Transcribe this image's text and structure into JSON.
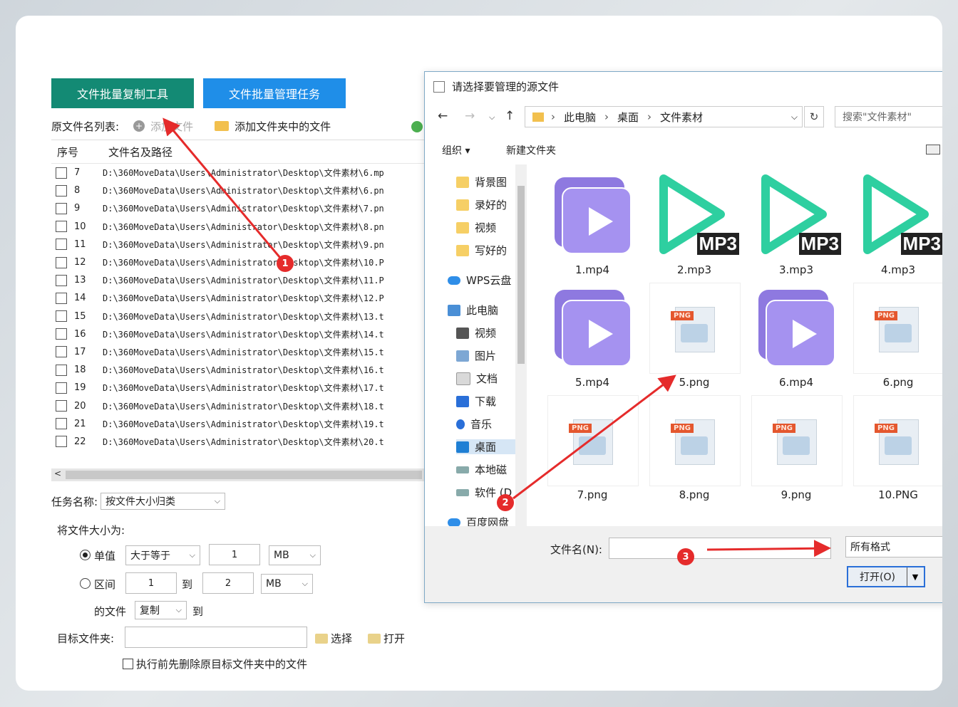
{
  "app": {
    "tabs": [
      {
        "label": "文件批量复制工具"
      },
      {
        "label": "文件批量管理任务"
      }
    ],
    "file_list_label": "原文件名列表:",
    "add_file_label": "添加文件",
    "add_folder_label": "添加文件夹中的文件",
    "table": {
      "headers": {
        "index": "序号",
        "path": "文件名及路径"
      },
      "rows": [
        {
          "index": "7",
          "path": "D:\\360MoveData\\Users\\Administrator\\Desktop\\文件素材\\6.mp"
        },
        {
          "index": "8",
          "path": "D:\\360MoveData\\Users\\Administrator\\Desktop\\文件素材\\6.pn"
        },
        {
          "index": "9",
          "path": "D:\\360MoveData\\Users\\Administrator\\Desktop\\文件素材\\7.pn"
        },
        {
          "index": "10",
          "path": "D:\\360MoveData\\Users\\Administrator\\Desktop\\文件素材\\8.pn"
        },
        {
          "index": "11",
          "path": "D:\\360MoveData\\Users\\Administrator\\Desktop\\文件素材\\9.pn"
        },
        {
          "index": "12",
          "path": "D:\\360MoveData\\Users\\Administrator\\Desktop\\文件素材\\10.P"
        },
        {
          "index": "13",
          "path": "D:\\360MoveData\\Users\\Administrator\\Desktop\\文件素材\\11.P"
        },
        {
          "index": "14",
          "path": "D:\\360MoveData\\Users\\Administrator\\Desktop\\文件素材\\12.P"
        },
        {
          "index": "15",
          "path": "D:\\360MoveData\\Users\\Administrator\\Desktop\\文件素材\\13.t"
        },
        {
          "index": "16",
          "path": "D:\\360MoveData\\Users\\Administrator\\Desktop\\文件素材\\14.t"
        },
        {
          "index": "17",
          "path": "D:\\360MoveData\\Users\\Administrator\\Desktop\\文件素材\\15.t"
        },
        {
          "index": "18",
          "path": "D:\\360MoveData\\Users\\Administrator\\Desktop\\文件素材\\16.t"
        },
        {
          "index": "19",
          "path": "D:\\360MoveData\\Users\\Administrator\\Desktop\\文件素材\\17.t"
        },
        {
          "index": "20",
          "path": "D:\\360MoveData\\Users\\Administrator\\Desktop\\文件素材\\18.t"
        },
        {
          "index": "21",
          "path": "D:\\360MoveData\\Users\\Administrator\\Desktop\\文件素材\\19.t"
        },
        {
          "index": "22",
          "path": "D:\\360MoveData\\Users\\Administrator\\Desktop\\文件素材\\20.t"
        }
      ]
    },
    "task": {
      "name_label": "任务名称:",
      "name_value": "按文件大小归类",
      "size_label": "将文件大小为:",
      "single_label": "单值",
      "single_cmp": "大于等于",
      "single_value": "1",
      "single_unit": "MB",
      "range_label": "区间",
      "range_from": "1",
      "range_to_label": "到",
      "range_to": "2",
      "range_unit": "MB",
      "file_label": "的文件",
      "action_value": "复制",
      "to_label": "到",
      "target_label": "目标文件夹:",
      "target_value": "",
      "choose_label": "选择",
      "open_label": "打开",
      "clear_label": "执行前先删除原目标文件夹中的文件"
    }
  },
  "dialog": {
    "title": "请选择要管理的源文件",
    "breadcrumb": [
      "此电脑",
      "桌面",
      "文件素材"
    ],
    "search_placeholder": "搜索\"文件素材\"",
    "organize_label": "组织 ▾",
    "new_folder_label": "新建文件夹",
    "nav_items": [
      {
        "label": "背景图",
        "icon": "folder-icon"
      },
      {
        "label": "录好的",
        "icon": "folder-icon"
      },
      {
        "label": "视频",
        "icon": "folder-icon"
      },
      {
        "label": "写好的",
        "icon": "folder-icon"
      },
      {
        "label": "WPS云盘",
        "icon": "cloud-icon"
      },
      {
        "label": "此电脑",
        "icon": "computer-icon"
      },
      {
        "label": "视频",
        "icon": "video-icon"
      },
      {
        "label": "图片",
        "icon": "picture-icon"
      },
      {
        "label": "文档",
        "icon": "document-icon"
      },
      {
        "label": "下载",
        "icon": "download-icon"
      },
      {
        "label": "音乐",
        "icon": "music-icon"
      },
      {
        "label": "桌面",
        "icon": "desktop-icon"
      },
      {
        "label": "本地磁",
        "icon": "disk-icon"
      },
      {
        "label": "软件 (D",
        "icon": "disk-icon"
      },
      {
        "label": "百度网盘",
        "icon": "cloud-icon"
      }
    ],
    "files": [
      {
        "name": "1.mp4",
        "kind": "video"
      },
      {
        "name": "2.mp3",
        "kind": "mp3"
      },
      {
        "name": "3.mp3",
        "kind": "mp3"
      },
      {
        "name": "4.mp3",
        "kind": "mp3"
      },
      {
        "name": "5.mp4",
        "kind": "video"
      },
      {
        "name": "5.png",
        "kind": "png"
      },
      {
        "name": "6.mp4",
        "kind": "video"
      },
      {
        "name": "6.png",
        "kind": "png"
      },
      {
        "name": "7.png",
        "kind": "png"
      },
      {
        "name": "8.png",
        "kind": "png"
      },
      {
        "name": "9.png",
        "kind": "png"
      },
      {
        "name": "10.PNG",
        "kind": "png"
      }
    ],
    "mp3_tag": "MP3",
    "png_tag": "PNG",
    "filename_label": "文件名(N):",
    "filename_value": "",
    "filetype_label": "所有格式",
    "open_button_label": "打开(O)"
  },
  "annotations": {
    "badges": [
      "1",
      "2",
      "3"
    ],
    "color": "#e52b2b"
  }
}
